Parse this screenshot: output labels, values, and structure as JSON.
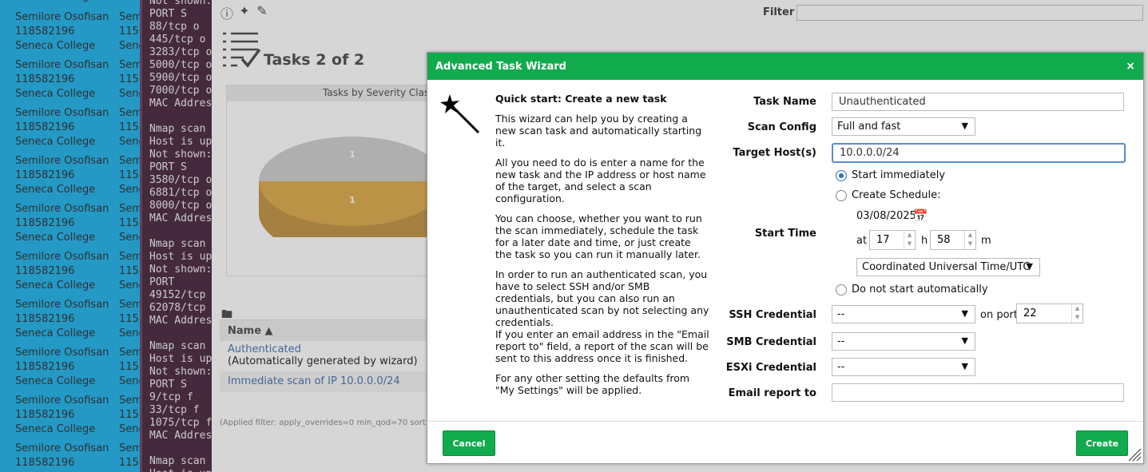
{
  "background_window": {
    "entries": [
      {
        "name": "Semilore Osofisan",
        "id": "118582196",
        "college": "Seneca College",
        "name2": "Sem",
        "id2": "115",
        "college2": "Sene"
      }
    ],
    "top_partial": "Seneca College"
  },
  "terminal": {
    "lines": [
      "Not shown:",
      "PORT     S",
      "88/tcp   o",
      "445/tcp  o",
      "3283/tcp o",
      "5000/tcp o",
      "5900/tcp o",
      "7000/tcp o",
      "MAC Addres",
      "",
      "Nmap scan",
      "Host is up",
      "Not shown:",
      "PORT     S",
      "3580/tcp o",
      "6881/tcp o",
      "8000/tcp o",
      "MAC Addres",
      "",
      "Nmap scan",
      "Host is up",
      "Not shown:",
      "PORT",
      "49152/tcp",
      "62078/tcp",
      "MAC Addres",
      "",
      "Nmap scan",
      "Host is up",
      "Not shown:",
      "PORT     S",
      "9/tcp    f",
      "33/tcp   f",
      "1075/tcp f",
      "MAC Addres",
      "",
      "Nmap scan",
      "Host is up"
    ]
  },
  "gsa": {
    "filter_label": "Filter",
    "tasks_title": "Tasks 2 of 2",
    "chart_header": "Tasks by Severity Clas",
    "pie_labels": [
      "1",
      "1"
    ],
    "pie_colors": {
      "top": "#c8c8c8",
      "bottom": "#d9a033"
    },
    "table_header": "Name ▲",
    "rows": [
      {
        "link": "Authenticated",
        "note": "(Automatically generated by wizard)"
      },
      {
        "link": "Immediate scan of IP 10.0.0.0/24",
        "note": ""
      }
    ],
    "applied_filter": "(Applied filter: apply_overrides=0 min_qod=70 sort"
  },
  "dialog": {
    "title": "Advanced Task Wizard",
    "close": "×",
    "quick_start_title": "Quick start: Create a new task",
    "paragraphs": [
      "This wizard can help you by creating a new scan task and automatically starting it.",
      "All you need to do is enter a name for the new task and the IP address or host name of the target, and select a scan configuration.",
      "You can choose, whether you want to run the scan immediately, schedule the task for a later date and time, or just create the task so you can run it manually later.",
      "In order to run an authenticated scan, you have to select SSH and/or SMB credentials, but you can also run an unauthenticated scan by not selecting any credentials.\nIf you enter an email address in the \"Email report to\" field, a report of the scan will be sent to this address once it is finished.",
      "For any other setting the defaults from \"My Settings\" will be applied."
    ],
    "labels": {
      "task_name": "Task Name",
      "scan_config": "Scan Config",
      "target_hosts": "Target Host(s)",
      "start_time": "Start Time",
      "ssh_credential": "SSH Credential",
      "smb_credential": "SMB Credential",
      "esxi_credential": "ESXi Credential",
      "email_report_to": "Email report to"
    },
    "values": {
      "task_name": "Unauthenticated",
      "scan_config": "Full and fast",
      "target_hosts": "10.0.0.0/24",
      "date": "03/08/2025",
      "hour": "17",
      "minute": "58",
      "timezone": "Coordinated Universal Time/UTC",
      "ssh_credential": "--",
      "ssh_port": "22",
      "smb_credential": "--",
      "esxi_credential": "--",
      "email": ""
    },
    "radios": {
      "start_immediately": "Start immediately",
      "create_schedule": "Create Schedule:",
      "do_not_start": "Do not start automatically",
      "selected": "start_immediately"
    },
    "at": "at",
    "h": "h",
    "m": "m",
    "on_port": "on port",
    "cancel": "Cancel",
    "create": "Create"
  }
}
